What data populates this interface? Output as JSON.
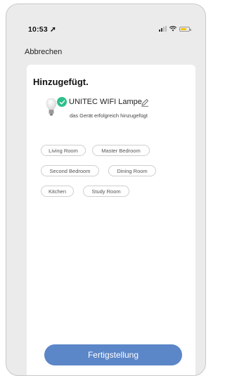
{
  "status_bar": {
    "time": "10:53"
  },
  "nav": {
    "cancel_label": "Abbrechen"
  },
  "card": {
    "title": "Hinzugefügt.",
    "device_name": "UNITEC WIFI Lampe",
    "device_status": "das Gerät erfolgreich hinzugefügt"
  },
  "rooms": [
    "Living Room",
    "Master Bedroom",
    "Second Bedroom",
    "Dining Room",
    "Kitchen",
    "Study Room"
  ],
  "finish_button": {
    "label": "Fertigstellung"
  },
  "colors": {
    "accent": "#5b86c8",
    "success": "#2cc08a",
    "battery": "#f6c500"
  }
}
